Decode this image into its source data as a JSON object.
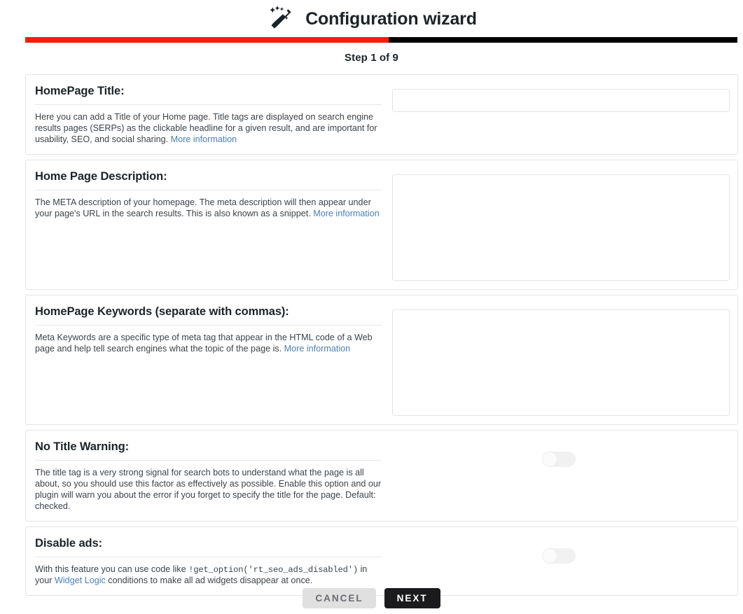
{
  "header": {
    "title": "Configuration wizard",
    "icon": "magic-wand-icon"
  },
  "progress": {
    "percent": 51,
    "fill_color": "#ff1a00",
    "track_color": "#000000"
  },
  "step": {
    "label": "Step 1 of 9",
    "current": 1,
    "total": 9
  },
  "link_color": "#4a7fb5",
  "sections": [
    {
      "id": "homepage-title",
      "title": "HomePage Title:",
      "desc_pre": "Here you can add a Title of your Home page. Title tags are displayed on search engine results pages (SERPs) as the clickable headline for a given result, and are important for usability, SEO, and social sharing. ",
      "link_text": "More information",
      "control": "text-input",
      "value": "",
      "placeholder": ""
    },
    {
      "id": "home-page-description",
      "title": "Home Page Description:",
      "desc_pre": "The META description of your homepage. The meta description will then appear under your page's URL in the search results. This is also known as a snippet. ",
      "link_text": "More information",
      "control": "textarea",
      "value": "",
      "placeholder": ""
    },
    {
      "id": "homepage-keywords",
      "title": "HomePage Keywords (separate with commas):",
      "desc_pre": "Meta Keywords are a specific type of meta tag that appear in the HTML code of a Web page and help tell search engines what the topic of the page is. ",
      "link_text": "More information",
      "control": "textarea",
      "value": "",
      "placeholder": ""
    },
    {
      "id": "no-title-warning",
      "title": "No Title Warning:",
      "desc_pre": "The title tag is a very strong signal for search bots to understand what the page is all about, so you should use this factor as effectively as possible. Enable this option and our plugin will warn you about the error if you forget to specify the title for the page. Default: checked.",
      "link_text": "",
      "control": "toggle",
      "value": "off"
    },
    {
      "id": "disable-ads",
      "title": "Disable ads:",
      "desc_pre": "With this feature you can use code like ",
      "code_text": "!get_option('rt_seo_ads_disabled')",
      "desc_mid": " in your ",
      "link_text": "Widget Logic",
      "desc_post": " conditions to make all ad widgets disappear at once.",
      "control": "toggle",
      "value": "off"
    }
  ],
  "footer": {
    "cancel_label": "CANCEL",
    "next_label": "NEXT"
  }
}
